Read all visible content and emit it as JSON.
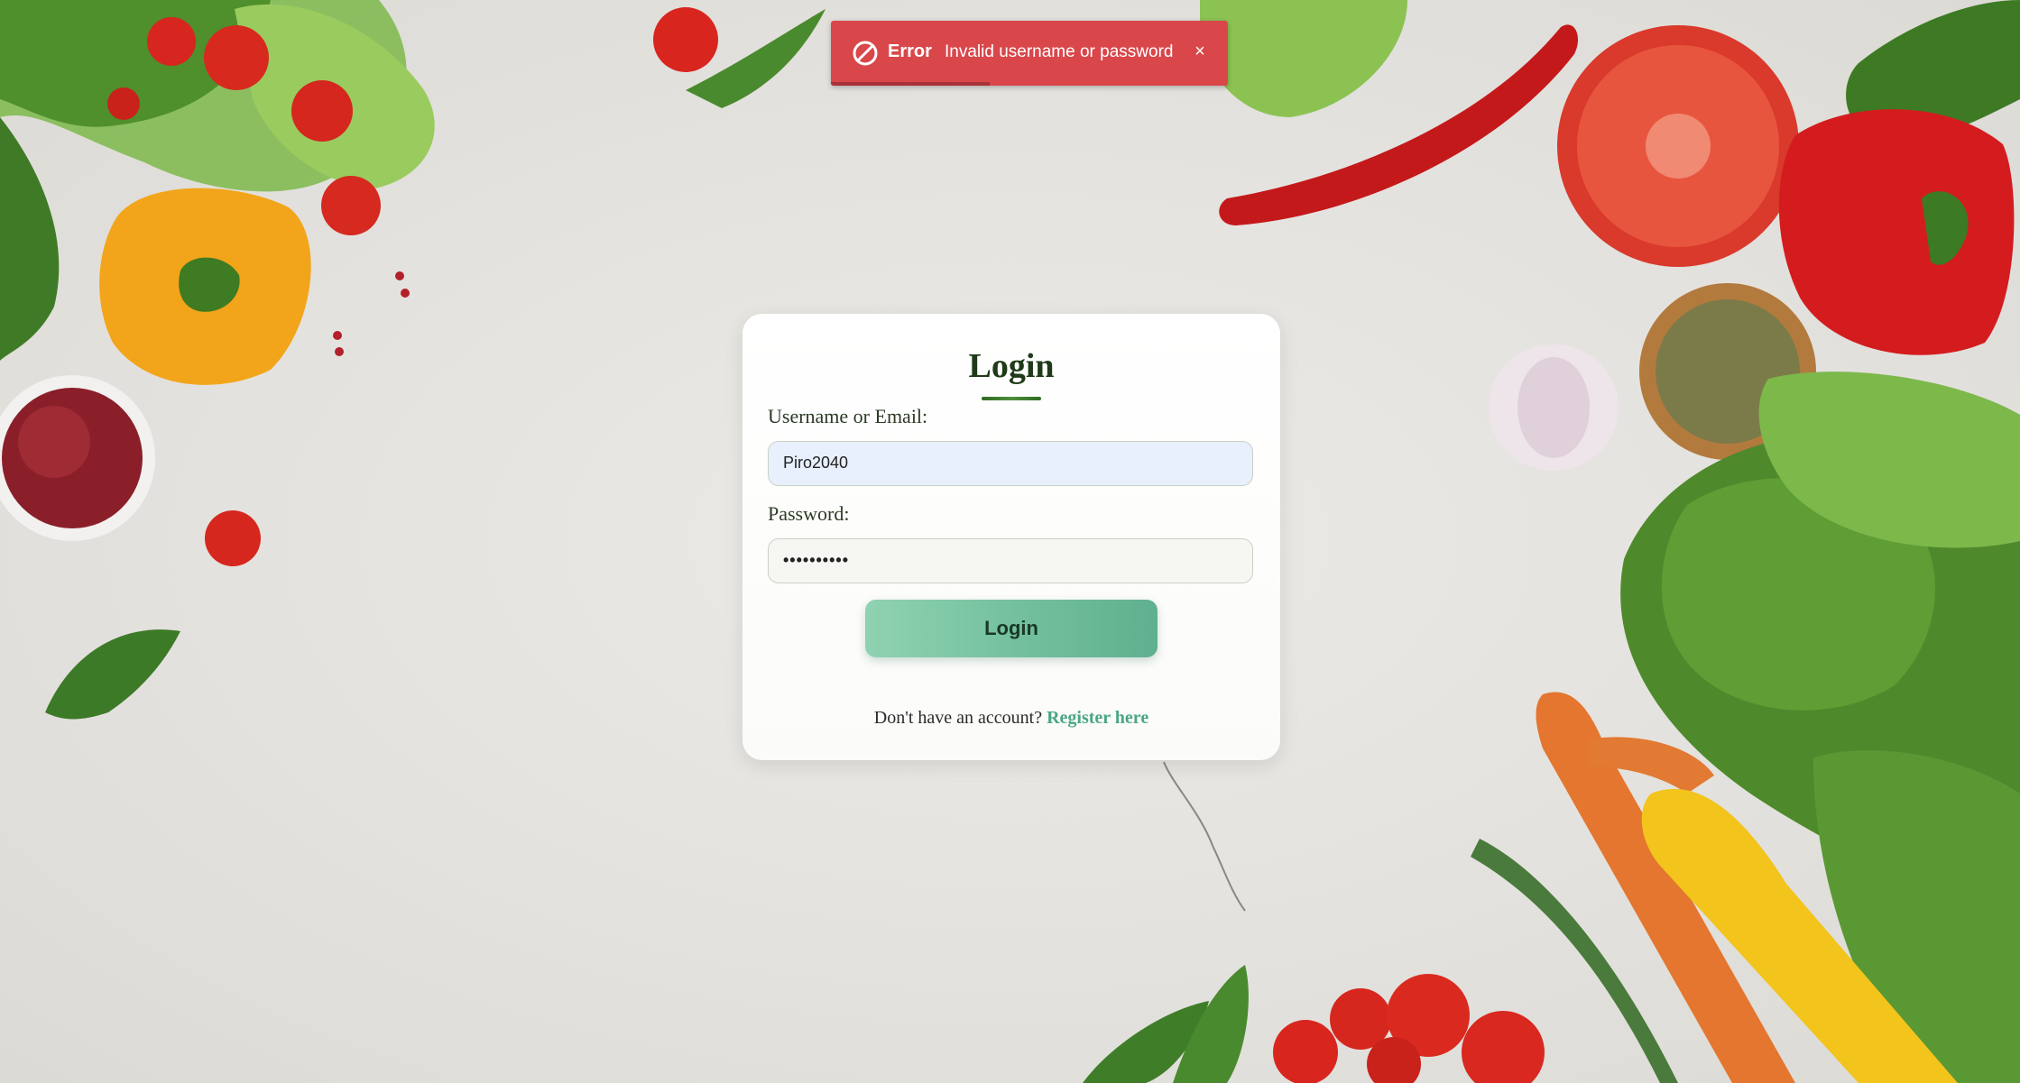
{
  "toast": {
    "icon": "ban-icon",
    "title": "Error",
    "message": "Invalid username or password",
    "close_icon": "close-icon",
    "progress_fraction": 0.4,
    "color": "#d9474b"
  },
  "login": {
    "title": "Login",
    "username_label": "Username or Email:",
    "username_value": "Piro2040",
    "password_label": "Password:",
    "password_value": "••••••••••",
    "submit_label": "Login",
    "register_prompt": "Don't have an account?",
    "register_link": "Register here",
    "accent_color": "#72bf9d"
  }
}
